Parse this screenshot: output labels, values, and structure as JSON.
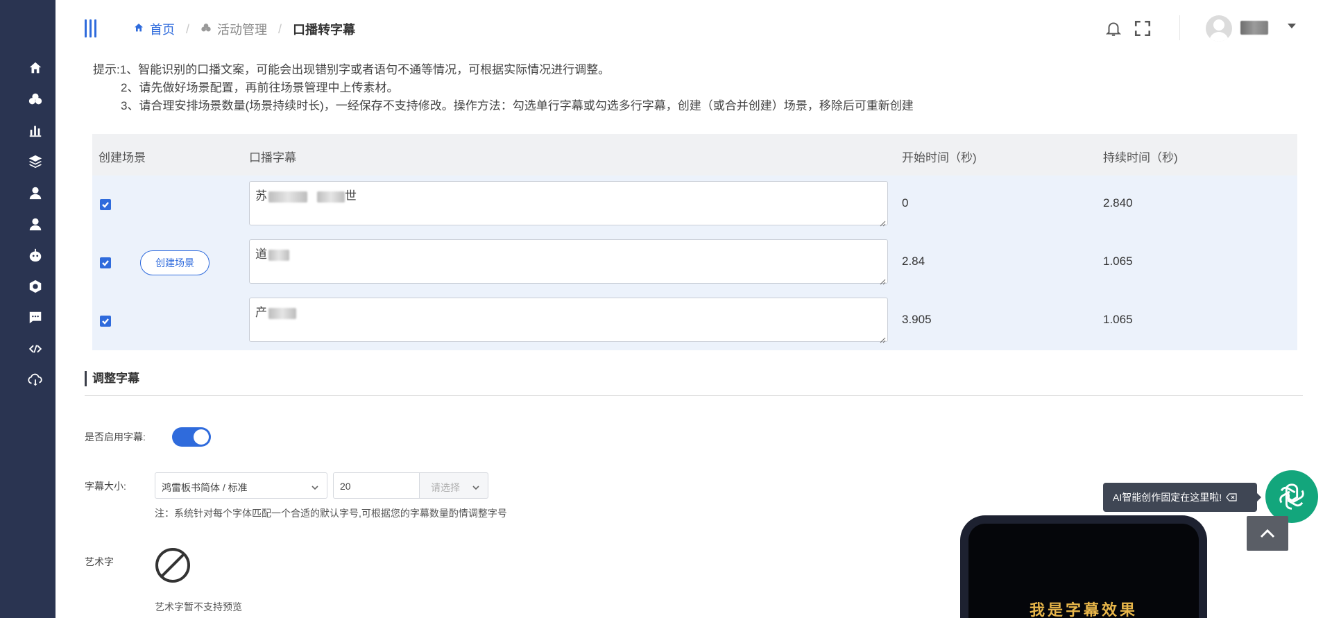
{
  "sidebar": {
    "items": [
      {
        "icon": "home-icon"
      },
      {
        "icon": "activity-icon"
      },
      {
        "icon": "chart-icon"
      },
      {
        "icon": "layers-icon"
      },
      {
        "icon": "user-icon"
      },
      {
        "icon": "user-alt-icon"
      },
      {
        "icon": "robot-icon"
      },
      {
        "icon": "settings-hexagon-icon"
      },
      {
        "icon": "chat-icon"
      },
      {
        "icon": "code-icon"
      },
      {
        "icon": "cloud-download-icon"
      }
    ]
  },
  "header": {
    "breadcrumb": {
      "home": "首页",
      "parent": "活动管理",
      "current": "口播转字幕",
      "separator": "/"
    }
  },
  "tips": {
    "line1": "提示:1、智能识别的口播文案，可能会出现错别字或者语句不通等情况，可根据实际情况进行调整。",
    "line2": "2、请先做好场景配置，再前往场景管理中上传素材。",
    "line3": "3、请合理安排场景数量(场景持续时长)，一经保存不支持修改。操作方法：勾选单行字幕或勾选多行字幕，创建（或合并创建）场景，移除后可重新创建"
  },
  "table": {
    "headers": {
      "create_scene": "创建场景",
      "subtitle": "口播字幕",
      "start_time": "开始时间（秒)",
      "duration": "持续时间（秒)"
    },
    "create_button_label": "创建场景",
    "rows": [
      {
        "checked": true,
        "text_prefix": "苏",
        "text_suffix": "世",
        "start": "0",
        "duration": "2.840"
      },
      {
        "checked": true,
        "text_prefix": "道",
        "text_suffix": "",
        "start": "2.84",
        "duration": "1.065"
      },
      {
        "checked": true,
        "text_prefix": "产",
        "text_suffix": "",
        "start": "3.905",
        "duration": "1.065"
      }
    ]
  },
  "subtitle_settings": {
    "section_title": "调整字幕",
    "enable_label": "是否启用字幕:",
    "enabled": true,
    "size_label": "字幕大小:",
    "font_value": "鸿雷板书简体 / 标准",
    "size_value": "20",
    "size_select_placeholder": "请选择",
    "note": "注：系统针对每个字体匹配一个合适的默认字号,可根据您的字幕数量酌情调整字号",
    "art_label": "艺术字",
    "art_note": "艺术字暂不支持预览"
  },
  "preview": {
    "subtitle_text": "我是字幕效果"
  },
  "floating": {
    "ai_tooltip": "AI智能创作固定在这里啦!"
  },
  "colors": {
    "sidebar_bg": "#2a3451",
    "accent": "#2f6bdc",
    "ai_green": "#13a67c",
    "preview_text": "#e8b64a"
  }
}
